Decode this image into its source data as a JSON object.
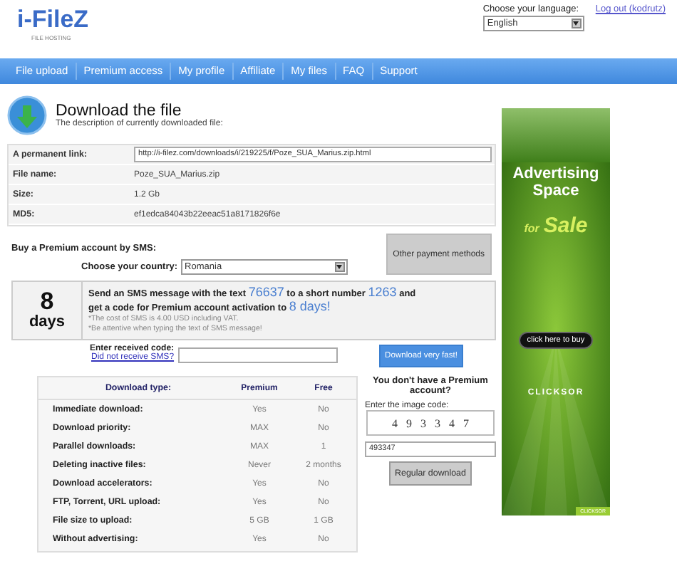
{
  "logo": {
    "name": "i-FileZ",
    "tagline": "FILE HOSTING"
  },
  "language": {
    "label": "Choose your language:",
    "value": "English"
  },
  "logout": "Log out (kodrutz)",
  "nav": [
    "File upload",
    "Premium access",
    "My profile",
    "Affiliate",
    "My files",
    "FAQ",
    "Support"
  ],
  "heading": {
    "title": "Download the file",
    "subtitle": "The description of currently downloaded file:"
  },
  "file_info": [
    {
      "label": "A permanent link:",
      "value": "http://i-filez.com/downloads/i/219225/f/Poze_SUA_Marius.zip.html",
      "kind": "field"
    },
    {
      "label": "File name:",
      "value": "Poze_SUA_Marius.zip",
      "kind": "text"
    },
    {
      "label": "Size:",
      "value": "1.2 Gb",
      "kind": "text"
    },
    {
      "label": "MD5:",
      "value": "ef1edca84043b22eeac51a8171826f6e",
      "kind": "text"
    }
  ],
  "sms": {
    "title": "Buy a Premium account by SMS:",
    "other_button": "Other payment methods",
    "country_label": "Choose your country:",
    "country": "Romania",
    "days_number": "8",
    "days_word": "days",
    "message": [
      {
        "text": "Send an SMS message with the text ",
        "kind": "text"
      },
      {
        "text": "76637",
        "kind": "highlight"
      },
      {
        "text": " to a short number ",
        "kind": "text"
      },
      {
        "text": "1263",
        "kind": "highlight"
      },
      {
        "text": " and get a code for Premium account activation to ",
        "kind": "text"
      },
      {
        "text": "8 days!",
        "kind": "highlight"
      }
    ],
    "notes": [
      "*The cost of SMS is 4.00 USD including VAT.",
      "*Be attentive when typing the text of SMS message!"
    ],
    "code_label": "Enter received code:",
    "no_sms_link": "Did not receive SMS?",
    "fast_button": "Download very fast!"
  },
  "comparison": {
    "columns": [
      "Download type:",
      "Premium",
      "Free"
    ],
    "rows": [
      [
        "Immediate download:",
        "Yes",
        "No"
      ],
      [
        "Download priority:",
        "MAX",
        "No"
      ],
      [
        "Parallel downloads:",
        "MAX",
        "1"
      ],
      [
        "Deleting inactive files:",
        "Never",
        "2 months"
      ],
      [
        "Download accelerators:",
        "Yes",
        "No"
      ],
      [
        "FTP, Torrent, URL upload:",
        "Yes",
        "No"
      ],
      [
        "File size to upload:",
        "5 GB",
        "1 GB"
      ],
      [
        "Without advertising:",
        "Yes",
        "No"
      ]
    ]
  },
  "free": {
    "title": "You don't have a Premium account?",
    "code_label": "Enter the image code:",
    "captcha": "4 9 3 3 4 7",
    "code_value": "493347",
    "button": "Regular download"
  },
  "ad": {
    "line1": "Advertising",
    "line2": "Space",
    "line3_small": "for",
    "line3_big": "Sale",
    "button": "click here to buy",
    "brand": "CLICKSOR",
    "badge": "CLICKSOR"
  }
}
